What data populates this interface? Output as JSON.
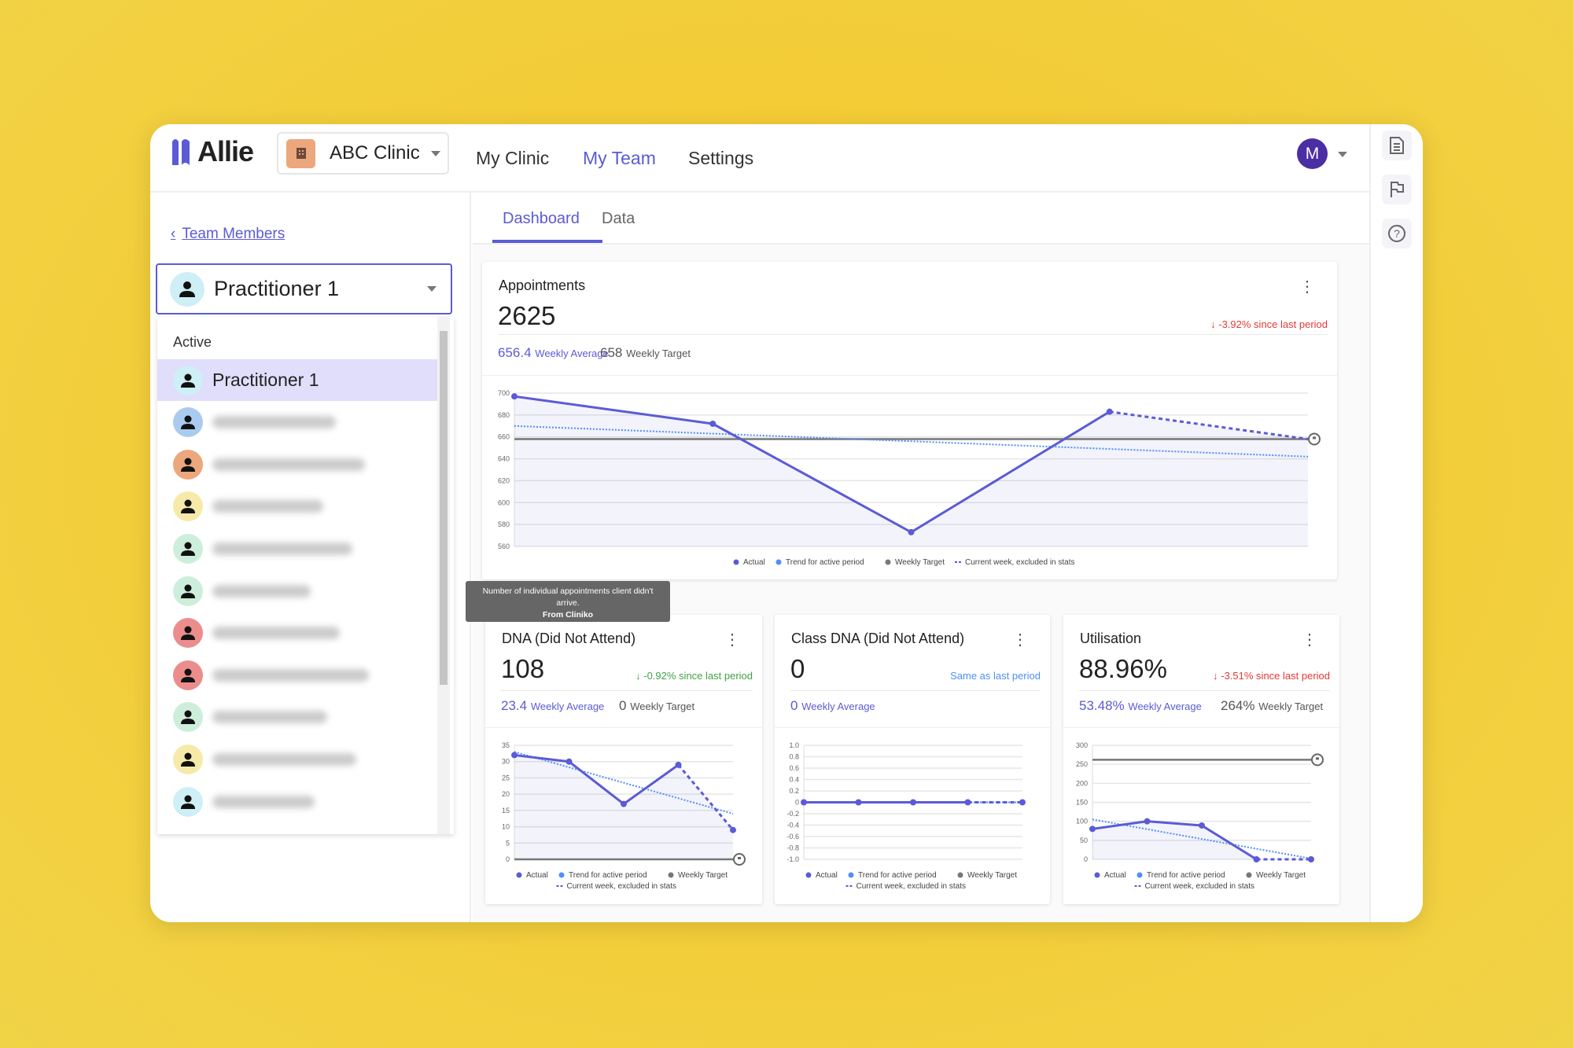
{
  "app": {
    "name": "Allie",
    "clinic": "ABC Clinic",
    "nav": [
      "My Clinic",
      "My Team",
      "Settings"
    ],
    "active_nav": "My Team",
    "user_initial": "M",
    "accent": "#5b5bd6"
  },
  "right_bar": {
    "icons": [
      "document-icon",
      "flag-icon",
      "help-icon"
    ]
  },
  "sidebar": {
    "back_link": "Team Members",
    "selected": "Practitioner 1",
    "group_label": "Active",
    "items": [
      {
        "label": "Practitioner 1",
        "color": "#cdeff5",
        "selected": true
      },
      {
        "color": "#a9cbf0"
      },
      {
        "color": "#eda77c"
      },
      {
        "color": "#f6eaa8"
      },
      {
        "color": "#cdeedb"
      },
      {
        "color": "#cdeedb"
      },
      {
        "color": "#ec8d8d"
      },
      {
        "color": "#ec8d8d"
      },
      {
        "color": "#cdeedb"
      },
      {
        "color": "#f6eaa8"
      },
      {
        "color": "#cdeff5"
      }
    ]
  },
  "tabs": [
    "Dashboard",
    "Data"
  ],
  "active_tab": "Dashboard",
  "tooltip": {
    "line1": "Number of individual appointments client didn't arrive.",
    "line2": "From Cliniko"
  },
  "cards": [
    {
      "title": "Appointments",
      "value": "2625",
      "change": "-3.92% since last period",
      "change_dir": "down",
      "change_color": "#e53935",
      "avg_value": "656.4",
      "avg_label": "Weekly Average",
      "target_value": "658",
      "target_label": "Weekly Target"
    },
    {
      "title": "DNA (Did Not Attend)",
      "value": "108",
      "change": "-0.92% since last period",
      "change_dir": "down",
      "change_color": "#43a047",
      "avg_value": "23.4",
      "avg_label": "Weekly Average",
      "target_value": "0",
      "target_label": "Weekly Target"
    },
    {
      "title": "Class DNA (Did Not Attend)",
      "value": "0",
      "change": "Same as last period",
      "change_dir": "none",
      "change_color": "#4f8ff7",
      "avg_value": "0",
      "avg_label": "Weekly Average"
    },
    {
      "title": "Utilisation",
      "value": "88.96%",
      "change": "-3.51% since last period",
      "change_dir": "down",
      "change_color": "#e53935",
      "avg_value": "53.48%",
      "avg_label": "Weekly Average",
      "target_value": "264%",
      "target_label": "Weekly Target"
    }
  ],
  "chart_data": [
    {
      "type": "line",
      "title": "Appointments",
      "yticks": [
        "700",
        "680",
        "660",
        "640",
        "620",
        "600",
        "580",
        "560"
      ],
      "ylim": [
        560,
        700
      ],
      "grid": true,
      "legend_position": "bottom",
      "actual": [
        697,
        672,
        573,
        683
      ],
      "current_week": [
        683,
        658
      ],
      "trend": [
        670,
        642
      ],
      "target": 658,
      "legend": [
        "Actual",
        "Trend for active period",
        "Weekly Target",
        "Current week, excluded in stats"
      ],
      "colors": {
        "actual": "#5b5bd6",
        "trend": "#4f8ff7",
        "target": "#777777"
      }
    },
    {
      "type": "line",
      "title": "DNA (Did Not Attend)",
      "yticks": [
        "35",
        "30",
        "25",
        "20",
        "15",
        "10",
        "5",
        "0"
      ],
      "ylim": [
        0,
        35
      ],
      "grid": true,
      "legend_position": "bottom",
      "actual": [
        32,
        30,
        17,
        29
      ],
      "current_week": [
        29,
        9
      ],
      "trend": [
        33,
        14
      ],
      "target": 0,
      "legend": [
        "Actual",
        "Trend for active period",
        "Weekly Target",
        "Current week, excluded in stats"
      ],
      "colors": {
        "actual": "#5b5bd6",
        "trend": "#4f8ff7",
        "target": "#777777"
      }
    },
    {
      "type": "line",
      "title": "Class DNA (Did Not Attend)",
      "yticks": [
        "1.0",
        "0.8",
        "0.6",
        "0.4",
        "0.2",
        "0",
        "-0.2",
        "-0.4",
        "-0.6",
        "-0.8",
        "-1.0"
      ],
      "ylim": [
        -1,
        1
      ],
      "grid": true,
      "legend_position": "bottom",
      "actual": [
        0,
        0,
        0,
        0
      ],
      "current_week": [
        0,
        0
      ],
      "trend": [
        0,
        0
      ],
      "target": null,
      "legend": [
        "Actual",
        "Trend for active period",
        "Weekly Target",
        "Current week, excluded in stats"
      ],
      "colors": {
        "actual": "#5b5bd6",
        "trend": "#4f8ff7",
        "target": "#777777"
      }
    },
    {
      "type": "line",
      "title": "Utilisation",
      "yticks": [
        "300",
        "250",
        "200",
        "150",
        "100",
        "50",
        "0"
      ],
      "ylim": [
        0,
        300
      ],
      "grid": true,
      "legend_position": "bottom",
      "actual": [
        80,
        100,
        89,
        0
      ],
      "current_week": [
        0,
        0
      ],
      "trend": [
        105,
        2
      ],
      "target": 262,
      "legend": [
        "Actual",
        "Trend for active period",
        "Weekly Target",
        "Current week, excluded in stats"
      ],
      "colors": {
        "actual": "#5b5bd6",
        "trend": "#4f8ff7",
        "target": "#777777"
      }
    }
  ]
}
